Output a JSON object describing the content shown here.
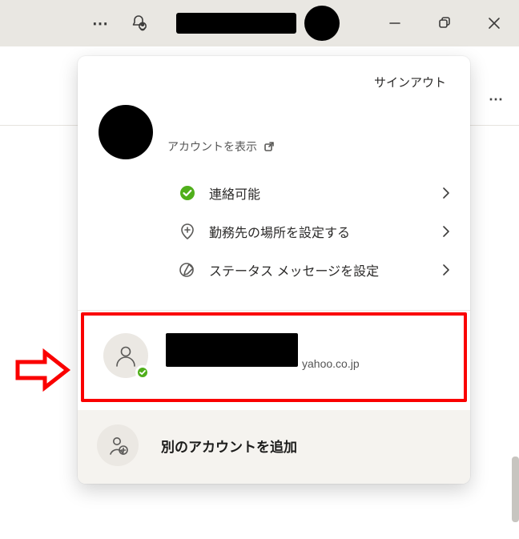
{
  "titlebar": {
    "ellipsis": "⋯",
    "minimize": "−",
    "close": "✕"
  },
  "right_ellipsis": "⋯",
  "card": {
    "signout": "サインアウト",
    "view_account": "アカウントを表示",
    "menu": {
      "available": "連絡可能",
      "set_location": "勤務先の場所を設定する",
      "set_status": "ステータス メッセージを設定"
    },
    "second_account": {
      "email_suffix": "yahoo.co.jp"
    },
    "add_account": "別のアカウントを追加"
  }
}
